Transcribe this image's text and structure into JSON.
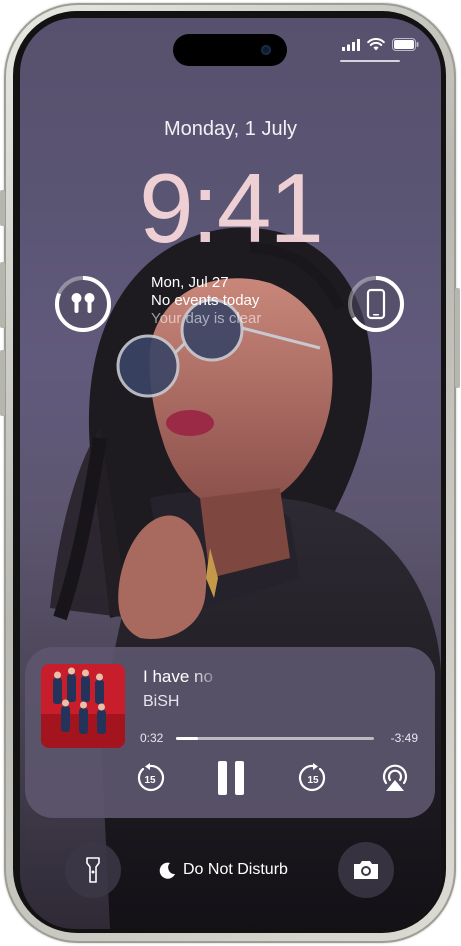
{
  "lock_screen": {
    "date": "Monday, 1 July",
    "time": "9:41"
  },
  "widgets": {
    "airpods_icon": "airpods-icon",
    "phone_battery_icon": "iphone-icon",
    "calendar": {
      "date": "Mon, Jul 27",
      "line1": "No events today",
      "line2": "Your day is clear"
    }
  },
  "now_playing": {
    "title": "I have no",
    "artist": "BiSH",
    "elapsed": "0:32",
    "remaining": "-3:49",
    "skip_back_seconds": "15",
    "skip_forward_seconds": "15",
    "progress": 0.11
  },
  "bottom": {
    "focus_mode": "Do Not Disturb"
  },
  "colors": {
    "time": "#f6d6da",
    "card": "#5c566e"
  }
}
